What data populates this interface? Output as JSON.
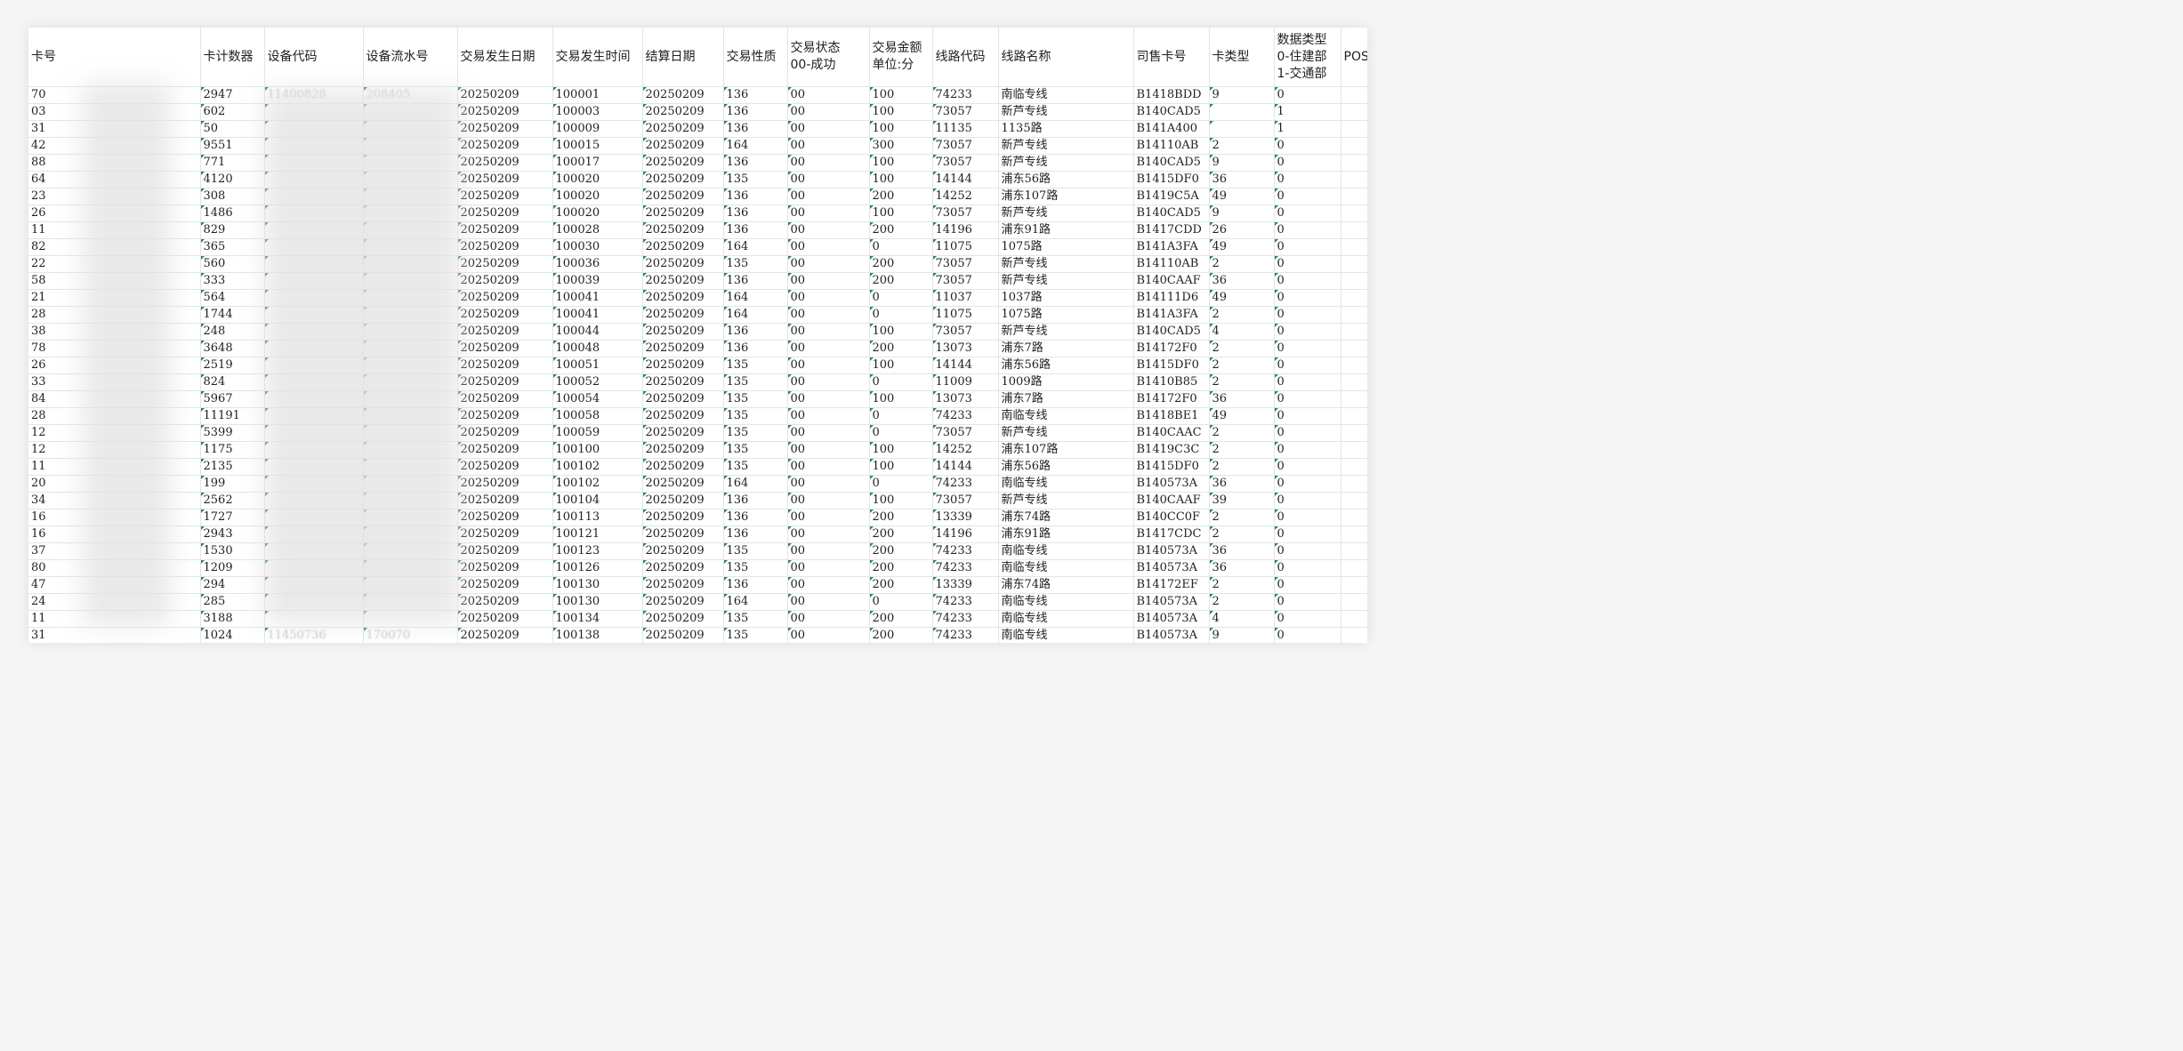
{
  "columns": [
    {
      "label": "卡号"
    },
    {
      "label": "卡计数器"
    },
    {
      "label": "设备代码"
    },
    {
      "label": "设备流水号"
    },
    {
      "label": "交易发生日期"
    },
    {
      "label": "交易发生时间"
    },
    {
      "label": "结算日期"
    },
    {
      "label": "交易性质"
    },
    {
      "label": "交易状态\n00-成功"
    },
    {
      "label": "交易金额\n单位:分"
    },
    {
      "label": "线路代码"
    },
    {
      "label": "线路名称"
    },
    {
      "label": "司售卡号"
    },
    {
      "label": "卡类型"
    },
    {
      "label": "数据类型\n0-住建部\n1-交通部"
    },
    {
      "label": "POS终"
    }
  ],
  "rows": [
    {
      "card_prefix": "70",
      "counter": "2947",
      "device_code": "11400828",
      "device_serial": "208405",
      "date": "20250209",
      "time": "100001",
      "settle_date": "20250209",
      "nature": "136",
      "status": "00",
      "amount": "100",
      "line_code": "74233",
      "line_name": "南临专线",
      "driver_card": "B1418BDD",
      "card_type": "9",
      "data_type": "0"
    },
    {
      "card_prefix": "03",
      "counter": "602",
      "device_code": "",
      "device_serial": "",
      "date": "20250209",
      "time": "100003",
      "settle_date": "20250209",
      "nature": "136",
      "status": "00",
      "amount": "100",
      "line_code": "73057",
      "line_name": "新芦专线",
      "driver_card": "B140CAD5",
      "card_type": "",
      "data_type": "1"
    },
    {
      "card_prefix": "31",
      "counter": "50",
      "device_code": "",
      "device_serial": "",
      "date": "20250209",
      "time": "100009",
      "settle_date": "20250209",
      "nature": "136",
      "status": "00",
      "amount": "100",
      "line_code": "11135",
      "line_name": "1135路",
      "driver_card": "B141A400",
      "card_type": "",
      "data_type": "1"
    },
    {
      "card_prefix": "42",
      "counter": "9551",
      "device_code": "",
      "device_serial": "",
      "date": "20250209",
      "time": "100015",
      "settle_date": "20250209",
      "nature": "164",
      "status": "00",
      "amount": "300",
      "line_code": "73057",
      "line_name": "新芦专线",
      "driver_card": "B14110AB",
      "card_type": "2",
      "data_type": "0"
    },
    {
      "card_prefix": "88",
      "counter": "771",
      "device_code": "",
      "device_serial": "",
      "date": "20250209",
      "time": "100017",
      "settle_date": "20250209",
      "nature": "136",
      "status": "00",
      "amount": "100",
      "line_code": "73057",
      "line_name": "新芦专线",
      "driver_card": "B140CAD5",
      "card_type": "9",
      "data_type": "0"
    },
    {
      "card_prefix": "64",
      "counter": "4120",
      "device_code": "",
      "device_serial": "",
      "date": "20250209",
      "time": "100020",
      "settle_date": "20250209",
      "nature": "135",
      "status": "00",
      "amount": "100",
      "line_code": "14144",
      "line_name": "浦东56路",
      "driver_card": "B1415DF0",
      "card_type": "36",
      "data_type": "0"
    },
    {
      "card_prefix": "23",
      "counter": "308",
      "device_code": "",
      "device_serial": "",
      "date": "20250209",
      "time": "100020",
      "settle_date": "20250209",
      "nature": "136",
      "status": "00",
      "amount": "200",
      "line_code": "14252",
      "line_name": "浦东107路",
      "driver_card": "B1419C5A",
      "card_type": "49",
      "data_type": "0"
    },
    {
      "card_prefix": "26",
      "counter": "1486",
      "device_code": "",
      "device_serial": "",
      "date": "20250209",
      "time": "100020",
      "settle_date": "20250209",
      "nature": "136",
      "status": "00",
      "amount": "100",
      "line_code": "73057",
      "line_name": "新芦专线",
      "driver_card": "B140CAD5",
      "card_type": "9",
      "data_type": "0"
    },
    {
      "card_prefix": "11",
      "counter": "829",
      "device_code": "",
      "device_serial": "",
      "date": "20250209",
      "time": "100028",
      "settle_date": "20250209",
      "nature": "136",
      "status": "00",
      "amount": "200",
      "line_code": "14196",
      "line_name": "浦东91路",
      "driver_card": "B1417CDD",
      "card_type": "26",
      "data_type": "0"
    },
    {
      "card_prefix": "82",
      "counter": "365",
      "device_code": "",
      "device_serial": "",
      "date": "20250209",
      "time": "100030",
      "settle_date": "20250209",
      "nature": "164",
      "status": "00",
      "amount": "0",
      "line_code": "11075",
      "line_name": "1075路",
      "driver_card": "B141A3FA",
      "card_type": "49",
      "data_type": "0"
    },
    {
      "card_prefix": "22",
      "counter": "560",
      "device_code": "",
      "device_serial": "",
      "date": "20250209",
      "time": "100036",
      "settle_date": "20250209",
      "nature": "135",
      "status": "00",
      "amount": "200",
      "line_code": "73057",
      "line_name": "新芦专线",
      "driver_card": "B14110AB",
      "card_type": "2",
      "data_type": "0"
    },
    {
      "card_prefix": "58",
      "counter": "333",
      "device_code": "",
      "device_serial": "",
      "date": "20250209",
      "time": "100039",
      "settle_date": "20250209",
      "nature": "136",
      "status": "00",
      "amount": "200",
      "line_code": "73057",
      "line_name": "新芦专线",
      "driver_card": "B140CAAF",
      "card_type": "36",
      "data_type": "0"
    },
    {
      "card_prefix": "21",
      "counter": "564",
      "device_code": "",
      "device_serial": "",
      "date": "20250209",
      "time": "100041",
      "settle_date": "20250209",
      "nature": "164",
      "status": "00",
      "amount": "0",
      "line_code": "11037",
      "line_name": "1037路",
      "driver_card": "B14111D6",
      "card_type": "49",
      "data_type": "0"
    },
    {
      "card_prefix": "28",
      "counter": "1744",
      "device_code": "",
      "device_serial": "",
      "date": "20250209",
      "time": "100041",
      "settle_date": "20250209",
      "nature": "164",
      "status": "00",
      "amount": "0",
      "line_code": "11075",
      "line_name": "1075路",
      "driver_card": "B141A3FA",
      "card_type": "2",
      "data_type": "0"
    },
    {
      "card_prefix": "38",
      "counter": "248",
      "device_code": "",
      "device_serial": "",
      "date": "20250209",
      "time": "100044",
      "settle_date": "20250209",
      "nature": "136",
      "status": "00",
      "amount": "100",
      "line_code": "73057",
      "line_name": "新芦专线",
      "driver_card": "B140CAD5",
      "card_type": "4",
      "data_type": "0"
    },
    {
      "card_prefix": "78",
      "counter": "3648",
      "device_code": "",
      "device_serial": "",
      "date": "20250209",
      "time": "100048",
      "settle_date": "20250209",
      "nature": "136",
      "status": "00",
      "amount": "200",
      "line_code": "13073",
      "line_name": "浦东7路",
      "driver_card": "B14172F0",
      "card_type": "2",
      "data_type": "0"
    },
    {
      "card_prefix": "26",
      "counter": "2519",
      "device_code": "",
      "device_serial": "",
      "date": "20250209",
      "time": "100051",
      "settle_date": "20250209",
      "nature": "135",
      "status": "00",
      "amount": "100",
      "line_code": "14144",
      "line_name": "浦东56路",
      "driver_card": "B1415DF0",
      "card_type": "2",
      "data_type": "0"
    },
    {
      "card_prefix": "33",
      "counter": "824",
      "device_code": "",
      "device_serial": "",
      "date": "20250209",
      "time": "100052",
      "settle_date": "20250209",
      "nature": "135",
      "status": "00",
      "amount": "0",
      "line_code": "11009",
      "line_name": "1009路",
      "driver_card": "B1410B85",
      "card_type": "2",
      "data_type": "0"
    },
    {
      "card_prefix": "84",
      "counter": "5967",
      "device_code": "",
      "device_serial": "",
      "date": "20250209",
      "time": "100054",
      "settle_date": "20250209",
      "nature": "135",
      "status": "00",
      "amount": "100",
      "line_code": "13073",
      "line_name": "浦东7路",
      "driver_card": "B14172F0",
      "card_type": "36",
      "data_type": "0"
    },
    {
      "card_prefix": "28",
      "counter": "11191",
      "device_code": "",
      "device_serial": "",
      "date": "20250209",
      "time": "100058",
      "settle_date": "20250209",
      "nature": "135",
      "status": "00",
      "amount": "0",
      "line_code": "74233",
      "line_name": "南临专线",
      "driver_card": "B1418BE1",
      "card_type": "49",
      "data_type": "0"
    },
    {
      "card_prefix": "12",
      "counter": "5399",
      "device_code": "",
      "device_serial": "",
      "date": "20250209",
      "time": "100059",
      "settle_date": "20250209",
      "nature": "135",
      "status": "00",
      "amount": "0",
      "line_code": "73057",
      "line_name": "新芦专线",
      "driver_card": "B140CAAC",
      "card_type": "2",
      "data_type": "0"
    },
    {
      "card_prefix": "12",
      "counter": "1175",
      "device_code": "",
      "device_serial": "",
      "date": "20250209",
      "time": "100100",
      "settle_date": "20250209",
      "nature": "135",
      "status": "00",
      "amount": "100",
      "line_code": "14252",
      "line_name": "浦东107路",
      "driver_card": "B1419C3C",
      "card_type": "2",
      "data_type": "0"
    },
    {
      "card_prefix": "11",
      "counter": "2135",
      "device_code": "",
      "device_serial": "",
      "date": "20250209",
      "time": "100102",
      "settle_date": "20250209",
      "nature": "135",
      "status": "00",
      "amount": "100",
      "line_code": "14144",
      "line_name": "浦东56路",
      "driver_card": "B1415DF0",
      "card_type": "2",
      "data_type": "0"
    },
    {
      "card_prefix": "20",
      "counter": "199",
      "device_code": "",
      "device_serial": "",
      "date": "20250209",
      "time": "100102",
      "settle_date": "20250209",
      "nature": "164",
      "status": "00",
      "amount": "0",
      "line_code": "74233",
      "line_name": "南临专线",
      "driver_card": "B140573A",
      "card_type": "36",
      "data_type": "0"
    },
    {
      "card_prefix": "34",
      "counter": "2562",
      "device_code": "",
      "device_serial": "",
      "date": "20250209",
      "time": "100104",
      "settle_date": "20250209",
      "nature": "136",
      "status": "00",
      "amount": "100",
      "line_code": "73057",
      "line_name": "新芦专线",
      "driver_card": "B140CAAF",
      "card_type": "39",
      "data_type": "0"
    },
    {
      "card_prefix": "16",
      "counter": "1727",
      "device_code": "",
      "device_serial": "",
      "date": "20250209",
      "time": "100113",
      "settle_date": "20250209",
      "nature": "136",
      "status": "00",
      "amount": "200",
      "line_code": "13339",
      "line_name": "浦东74路",
      "driver_card": "B140CC0F",
      "card_type": "2",
      "data_type": "0"
    },
    {
      "card_prefix": "16",
      "counter": "2943",
      "device_code": "",
      "device_serial": "",
      "date": "20250209",
      "time": "100121",
      "settle_date": "20250209",
      "nature": "136",
      "status": "00",
      "amount": "200",
      "line_code": "14196",
      "line_name": "浦东91路",
      "driver_card": "B1417CDC",
      "card_type": "2",
      "data_type": "0"
    },
    {
      "card_prefix": "37",
      "counter": "1530",
      "device_code": "",
      "device_serial": "",
      "date": "20250209",
      "time": "100123",
      "settle_date": "20250209",
      "nature": "135",
      "status": "00",
      "amount": "200",
      "line_code": "74233",
      "line_name": "南临专线",
      "driver_card": "B140573A",
      "card_type": "36",
      "data_type": "0"
    },
    {
      "card_prefix": "80",
      "counter": "1209",
      "device_code": "",
      "device_serial": "",
      "date": "20250209",
      "time": "100126",
      "settle_date": "20250209",
      "nature": "135",
      "status": "00",
      "amount": "200",
      "line_code": "74233",
      "line_name": "南临专线",
      "driver_card": "B140573A",
      "card_type": "36",
      "data_type": "0"
    },
    {
      "card_prefix": "47",
      "counter": "294",
      "device_code": "",
      "device_serial": "",
      "date": "20250209",
      "time": "100130",
      "settle_date": "20250209",
      "nature": "136",
      "status": "00",
      "amount": "200",
      "line_code": "13339",
      "line_name": "浦东74路",
      "driver_card": "B14172EF",
      "card_type": "2",
      "data_type": "0"
    },
    {
      "card_prefix": "24",
      "counter": "285",
      "device_code": "",
      "device_serial": "",
      "date": "20250209",
      "time": "100130",
      "settle_date": "20250209",
      "nature": "164",
      "status": "00",
      "amount": "0",
      "line_code": "74233",
      "line_name": "南临专线",
      "driver_card": "B140573A",
      "card_type": "2",
      "data_type": "0"
    },
    {
      "card_prefix": "11",
      "counter": "3188",
      "device_code": "",
      "device_serial": "",
      "date": "20250209",
      "time": "100134",
      "settle_date": "20250209",
      "nature": "135",
      "status": "00",
      "amount": "200",
      "line_code": "74233",
      "line_name": "南临专线",
      "driver_card": "B140573A",
      "card_type": "4",
      "data_type": "0"
    },
    {
      "card_prefix": "31",
      "counter": "1024",
      "device_code": "11450736",
      "device_serial": "170070",
      "date": "20250209",
      "time": "100138",
      "settle_date": "20250209",
      "nature": "135",
      "status": "00",
      "amount": "200",
      "line_code": "74233",
      "line_name": "南临专线",
      "driver_card": "B140573A",
      "card_type": "9",
      "data_type": "0"
    }
  ],
  "colors": {
    "green_marker": "#1e8e3e",
    "grid_line": "#e4e4e4",
    "background": "#ffffff"
  }
}
